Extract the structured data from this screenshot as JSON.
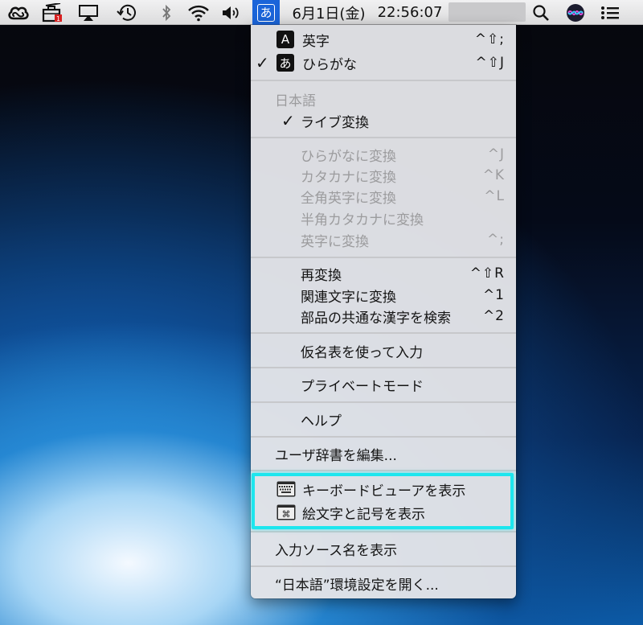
{
  "menubar": {
    "icons": [
      "creative-cloud-icon",
      "toolbox-icon",
      "airplay-icon",
      "time-machine-icon",
      "bluetooth-icon",
      "wifi-icon",
      "volume-icon"
    ],
    "input_indicator": "あ",
    "date": "6月1日(金)",
    "time": "22:56:07",
    "right_icons": [
      "search-icon",
      "siri-icon",
      "notification-center-icon"
    ]
  },
  "menu": {
    "modes": [
      {
        "badge": "A",
        "label": "英字",
        "shortcut": "^⇧;",
        "checked": false
      },
      {
        "badge": "あ",
        "label": "ひらがな",
        "shortcut": "^⇧J",
        "checked": true
      }
    ],
    "section_header": "日本語",
    "live_conversion": "ライブ変換",
    "convert_items": [
      {
        "label": "ひらがなに変換",
        "shortcut": "^J"
      },
      {
        "label": "カタカナに変換",
        "shortcut": "^K"
      },
      {
        "label": "全角英字に変換",
        "shortcut": "^L"
      },
      {
        "label": "半角カタカナに変換",
        "shortcut": ""
      },
      {
        "label": "英字に変換",
        "shortcut": "^;"
      }
    ],
    "tool_items": [
      {
        "label": "再変換",
        "shortcut": "^⇧R"
      },
      {
        "label": "関連文字に変換",
        "shortcut": "^1"
      },
      {
        "label": "部品の共通な漢字を検索",
        "shortcut": "^2"
      }
    ],
    "kana_table": "仮名表を使って入力",
    "private_mode": "プライベートモード",
    "help": "ヘルプ",
    "edit_dictionary": "ユーザ辞書を編集...",
    "keyboard_viewer": "キーボードビューアを表示",
    "emoji_symbols": "絵文字と記号を表示",
    "show_source_name": "入力ソース名を表示",
    "open_prefs": "“日本語”環境設定を開く..."
  }
}
